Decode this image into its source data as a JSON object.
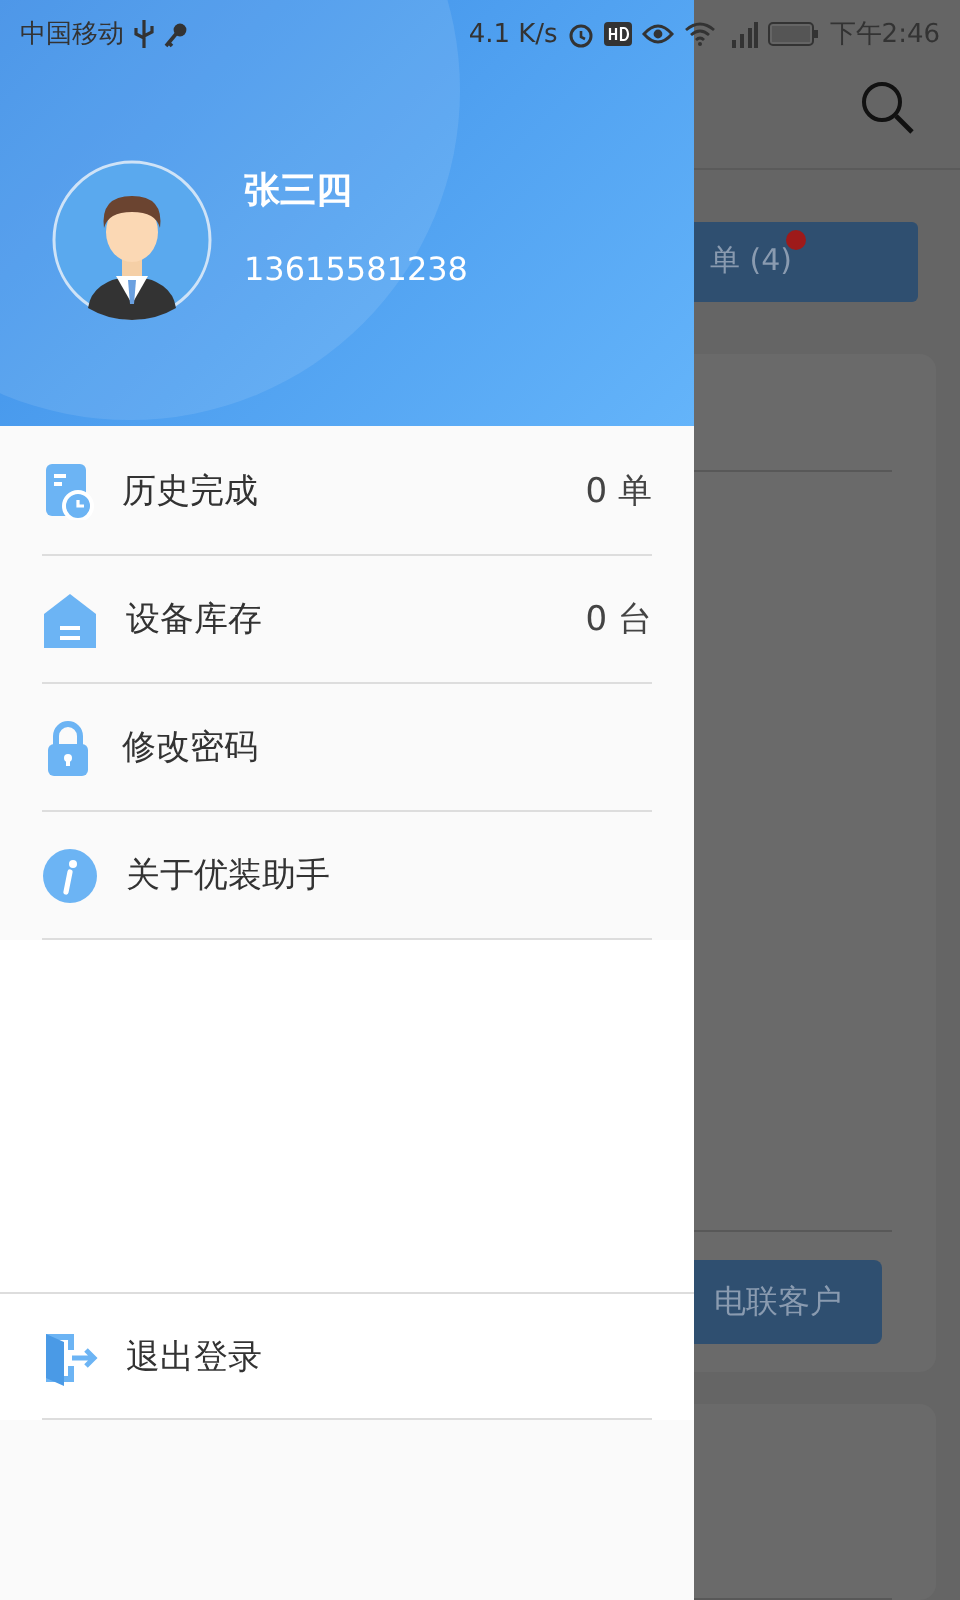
{
  "status_bar": {
    "carrier": "中国移动",
    "speed": "4.1 K/s",
    "time": "下午2:46"
  },
  "profile": {
    "name": "张三四",
    "phone": "13615581238"
  },
  "menu": [
    {
      "kind": "history",
      "label": "历史完成",
      "count": "0 单"
    },
    {
      "kind": "stock",
      "label": "设备库存",
      "count": "0 台"
    },
    {
      "kind": "password",
      "label": "修改密码"
    },
    {
      "kind": "about",
      "label": "关于优装助手"
    }
  ],
  "logout": {
    "label": "退出登录"
  },
  "background": {
    "order_button": "单 (4)",
    "order_badge": true,
    "call_button": "电联客户"
  }
}
